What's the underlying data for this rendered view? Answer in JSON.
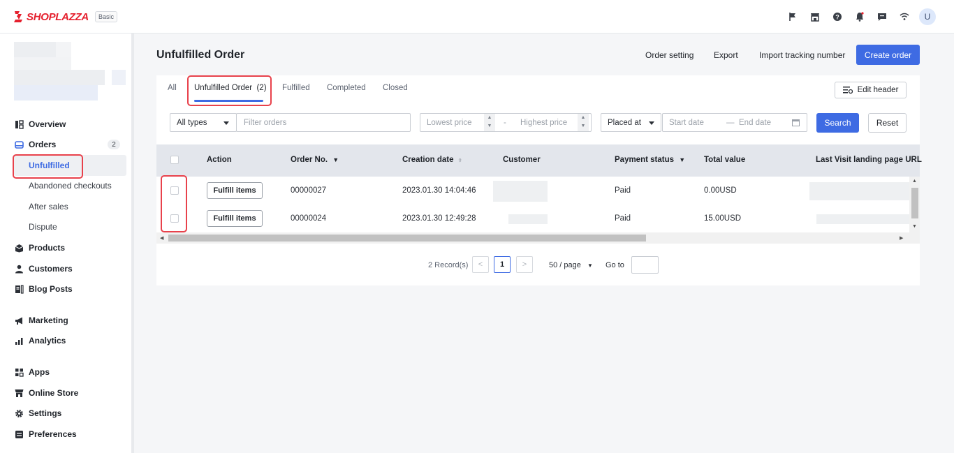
{
  "topbar": {
    "brand": "SHOPLAZZA",
    "plan": "Basic",
    "icons": [
      "flag-icon",
      "store-icon",
      "help-icon",
      "bell-icon",
      "message-icon",
      "wifi-icon"
    ],
    "avatar_initial": "U"
  },
  "sidebar": {
    "items": [
      {
        "label": "Overview",
        "icon": "overview-icon"
      },
      {
        "label": "Orders",
        "icon": "orders-icon",
        "badge": "2"
      },
      {
        "label": "Products",
        "icon": "products-icon"
      },
      {
        "label": "Customers",
        "icon": "customers-icon"
      },
      {
        "label": "Blog Posts",
        "icon": "blog-icon"
      },
      {
        "label": "Marketing",
        "icon": "megaphone-icon"
      },
      {
        "label": "Analytics",
        "icon": "analytics-icon"
      },
      {
        "label": "Apps",
        "icon": "apps-icon"
      },
      {
        "label": "Online Store",
        "icon": "store-icon"
      },
      {
        "label": "Settings",
        "icon": "gear-icon"
      },
      {
        "label": "Preferences",
        "icon": "preferences-icon"
      }
    ],
    "order_subitems": [
      "Unfulfilled",
      "Abandoned checkouts",
      "After sales",
      "Dispute"
    ]
  },
  "main": {
    "title": "Unfulfilled Order",
    "actions": {
      "order_setting": "Order setting",
      "export": "Export",
      "import_tracking": "Import tracking number",
      "create_order": "Create order"
    },
    "tabs": [
      "All",
      "Unfulfilled Order  (2)",
      "Fulfilled",
      "Completed",
      "Closed"
    ],
    "edit_header": "Edit header",
    "filters": {
      "type_select": "All types",
      "search_placeholder": "Filter orders",
      "lowest_price_placeholder": "Lowest price",
      "range_separator": "-",
      "highest_price_placeholder": "Highest price",
      "date_type": "Placed at",
      "start_date_placeholder": "Start date",
      "date_separator": "—",
      "end_date_placeholder": "End date",
      "search_button": "Search",
      "reset_button": "Reset"
    },
    "table": {
      "headers": [
        "Action",
        "Order No.",
        "Creation date",
        "Customer",
        "Payment status",
        "Total value",
        "Last Visit landing page URL"
      ],
      "rows": [
        {
          "action": "Fulfill items",
          "order_no": "00000027",
          "created": "2023.01.30 14:04:46",
          "payment": "Paid",
          "total": "0.00USD"
        },
        {
          "action": "Fulfill items",
          "order_no": "00000024",
          "created": "2023.01.30 12:49:28",
          "payment": "Paid",
          "total": "15.00USD"
        }
      ]
    },
    "pagination": {
      "records": "2 Record(s)",
      "prev": "<",
      "current_page": "1",
      "next": ">",
      "page_size": "50 / page",
      "goto_label": "Go to",
      "goto_value": ""
    }
  }
}
